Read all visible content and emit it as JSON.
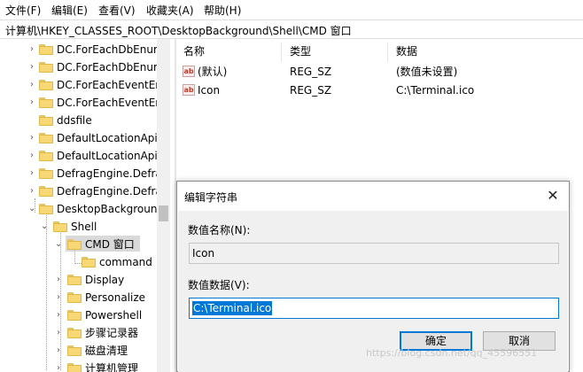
{
  "menu": [
    "文件(F)",
    "编辑(E)",
    "查看(V)",
    "收藏夹(A)",
    "帮助(H)"
  ],
  "address": "计算机\\HKEY_CLASSES_ROOT\\DesktopBackground\\Shell\\CMD 窗口",
  "tree": [
    {
      "label": "DC.ForEachDbEnum",
      "expander": "collapsed"
    },
    {
      "label": "DC.ForEachDbEnum",
      "expander": "collapsed"
    },
    {
      "label": "DC.ForEachEventEn",
      "expander": "collapsed"
    },
    {
      "label": "DC.ForEachEventEn",
      "expander": "collapsed"
    },
    {
      "label": "ddsfile",
      "expander": "none"
    },
    {
      "label": "DefaultLocationApi",
      "expander": "collapsed"
    },
    {
      "label": "DefaultLocationApi.",
      "expander": "collapsed"
    },
    {
      "label": "DefragEngine.Defra",
      "expander": "collapsed"
    },
    {
      "label": "DefragEngine.Defra",
      "expander": "collapsed"
    },
    {
      "label": "DesktopBackgroun",
      "expander": "expanded"
    },
    {
      "label": "Shell",
      "expander": "expanded"
    },
    {
      "label": "CMD 窗口",
      "expander": "expanded",
      "selected": true
    },
    {
      "label": "command",
      "expander": "none"
    },
    {
      "label": "Display",
      "expander": "collapsed"
    },
    {
      "label": "Personalize",
      "expander": "collapsed"
    },
    {
      "label": "Powershell",
      "expander": "collapsed"
    },
    {
      "label": "步骤记录器",
      "expander": "collapsed"
    },
    {
      "label": "磁盘清理",
      "expander": "collapsed"
    },
    {
      "label": "计算机管理",
      "expander": "collapsed"
    }
  ],
  "columns": {
    "name": "名称",
    "type": "类型",
    "data": "数据"
  },
  "values": [
    {
      "icon": "string-value-icon",
      "name": "(默认)",
      "type": "REG_SZ",
      "data": "(数值未设置)"
    },
    {
      "icon": "string-value-icon",
      "name": "Icon",
      "type": "REG_SZ",
      "data": "C:\\Terminal.ico"
    }
  ],
  "dialog": {
    "title": "编辑字符串",
    "close_icon": "close-icon",
    "name_label": "数值名称(N):",
    "name_value": "Icon",
    "data_label": "数值数据(V):",
    "data_value": "C:\\Terminal.ico",
    "ok_label": "确定",
    "cancel_label": "取消"
  },
  "watermark": "https://blog.csdn.net/qq_45596551",
  "colors": {
    "accent": "#0078d7",
    "folder": "#f8d775",
    "selection": "#d9d9d9"
  }
}
